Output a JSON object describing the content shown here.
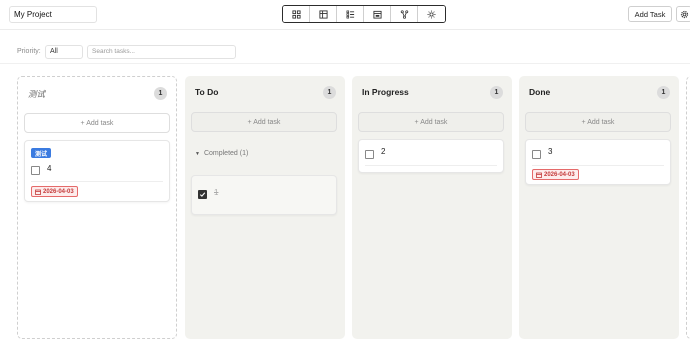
{
  "header": {
    "project_name": "My Project",
    "add_task_label": "Add Task",
    "views": [
      {
        "icon": "grid-icon"
      },
      {
        "icon": "table-icon"
      },
      {
        "icon": "list-icon"
      },
      {
        "icon": "calendar-icon"
      },
      {
        "icon": "graph-icon"
      },
      {
        "icon": "sun-icon"
      }
    ],
    "settings_icon": "gear-icon"
  },
  "filters": {
    "priority_label": "Priority:",
    "priority_value": "All",
    "search_placeholder": "Search tasks..."
  },
  "columns": [
    {
      "title": "测试",
      "count": "1",
      "add_label": "+ Add task",
      "cards": [
        {
          "tag": "测试",
          "title": "4",
          "date": "2026-04-03",
          "checked": false
        }
      ]
    },
    {
      "title": "To Do",
      "count": "1",
      "add_label": "+ Add task",
      "completed_label": "Completed (1)",
      "completed_cards": [
        {
          "title": "1",
          "checked": true
        }
      ]
    },
    {
      "title": "In Progress",
      "count": "1",
      "add_label": "+ Add task",
      "cards": [
        {
          "title": "2",
          "checked": false
        }
      ]
    },
    {
      "title": "Done",
      "count": "1",
      "add_label": "+ Add task",
      "cards": [
        {
          "title": "3",
          "date": "2026-04-03",
          "checked": false
        }
      ]
    }
  ],
  "colors": {
    "tag_blue": "#3b7be0",
    "date_red": "#c43a3a",
    "column_bg": "#f2f2ee"
  }
}
